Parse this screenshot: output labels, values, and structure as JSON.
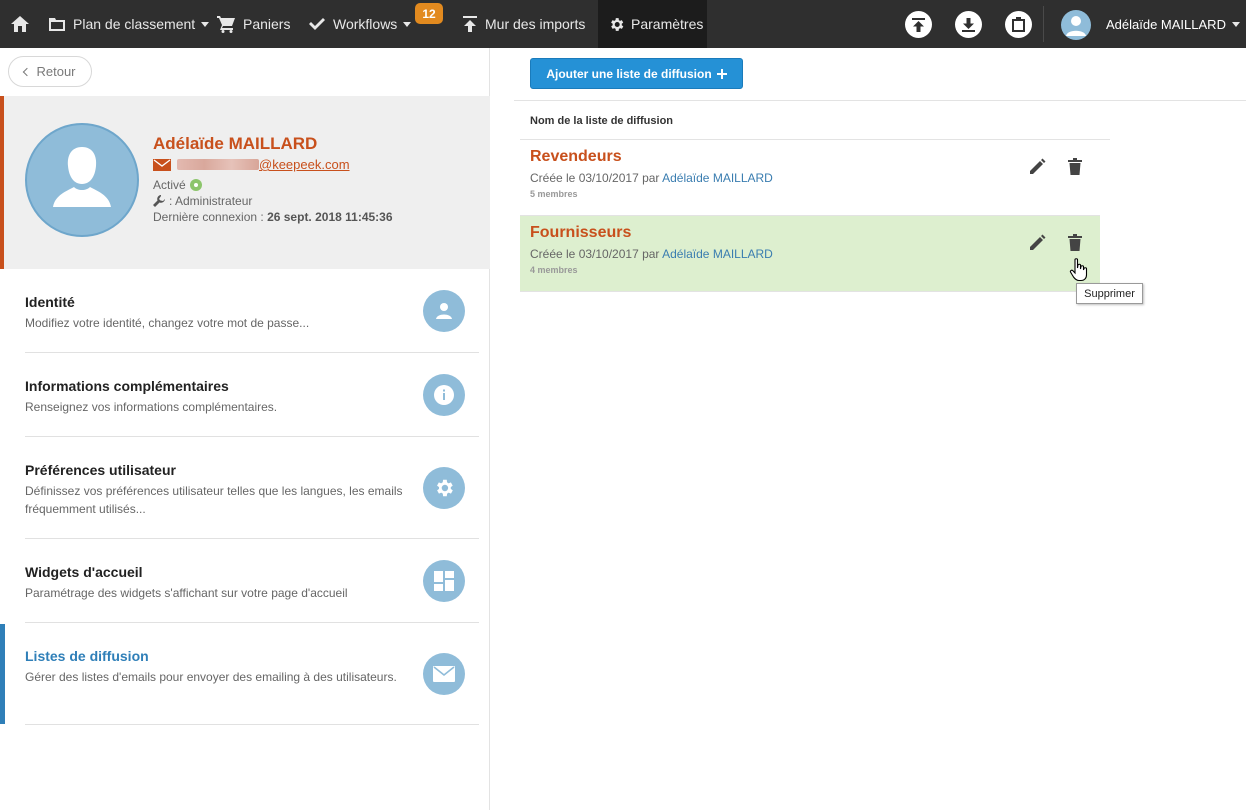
{
  "nav": {
    "plan_label": "Plan de classement",
    "baskets_label": "Paniers",
    "workflows_label": "Workflows",
    "workflows_badge": "12",
    "imports_label": "Mur des imports",
    "settings_label": "Paramètres",
    "user_name": "Adélaïde MAILLARD"
  },
  "left": {
    "back_label": "Retour",
    "profile": {
      "name": "Adélaïde MAILLARD",
      "email_domain": "@keepeek.com",
      "status": "Activé",
      "role": ": Administrateur",
      "last_login_label": "Dernière connexion :",
      "last_login_value": "26 sept. 2018 11:45:36"
    },
    "menu": [
      {
        "title": "Identité",
        "desc": "Modifiez votre identité, changez votre mot de passe...",
        "icon": "person-icon"
      },
      {
        "title": "Informations complémentaires",
        "desc": "Renseignez vos informations complémentaires.",
        "icon": "info-icon"
      },
      {
        "title": "Préférences utilisateur",
        "desc": "Définissez vos préférences utilisateur telles que les langues, les emails fréquemment utilisés...",
        "icon": "gear-icon"
      },
      {
        "title": "Widgets d'accueil",
        "desc": "Paramétrage des widgets s'affichant sur votre page d'accueil",
        "icon": "widgets-icon"
      },
      {
        "title": "Listes de diffusion",
        "desc": "Gérer des listes d'emails pour envoyer des emailing à des utilisateurs.",
        "icon": "envelope-icon"
      }
    ]
  },
  "main": {
    "add_button_label": "Ajouter une liste de diffusion",
    "column_header": "Nom de la liste de diffusion",
    "lists": [
      {
        "name": "Revendeurs",
        "created_prefix": "Créée le 03/10/2017 par",
        "created_by": "Adélaïde MAILLARD",
        "members": "5 membres"
      },
      {
        "name": "Fournisseurs",
        "created_prefix": "Créée le 03/10/2017 par",
        "created_by": "Adélaïde MAILLARD",
        "members": "4 membres"
      }
    ],
    "tooltip": "Supprimer"
  },
  "colors": {
    "topbar": "#2f2f2f",
    "accent_orange": "#c8501c",
    "accent_blue": "#2591d6",
    "icon_circle": "#8fbcd9",
    "hover_row": "#ddefcf",
    "badge": "#e28a1f"
  }
}
